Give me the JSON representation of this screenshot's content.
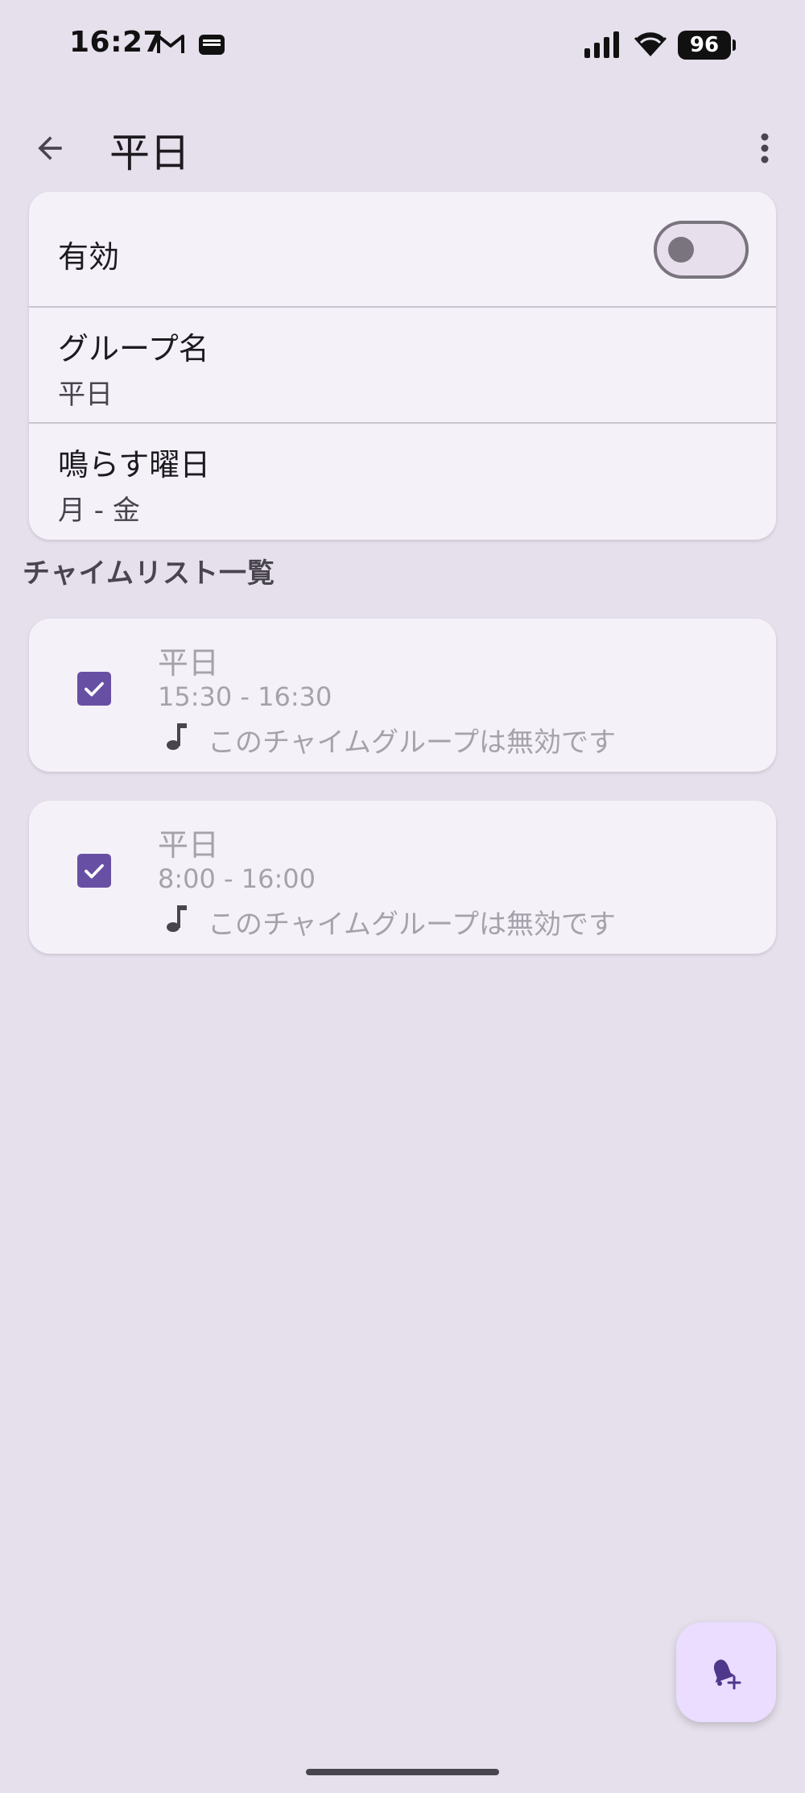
{
  "status_bar": {
    "time": "16:27",
    "battery": "96"
  },
  "app_bar": {
    "title": "平日"
  },
  "settings": {
    "enabled_label": "有効",
    "enabled": false,
    "group_name_label": "グループ名",
    "group_name_value": "平日",
    "days_label": "鳴らす曜日",
    "days_value": "月 - 金"
  },
  "section": {
    "title": "チャイムリスト一覧"
  },
  "chimes": [
    {
      "name": "平日",
      "time": "15:30 - 16:30",
      "status": "このチャイムグループは無効です",
      "checked": true
    },
    {
      "name": "平日",
      "time": "8:00 - 16:00",
      "status": "このチャイムグループは無効です",
      "checked": true
    }
  ],
  "colors": {
    "background": "#e6e0ec",
    "surface": "#f5f1f9",
    "primary": "#6750a4",
    "fab": "#eaddff"
  },
  "icons": {
    "back": "arrow-back-icon",
    "more": "more-vert-icon",
    "note": "music-note-icon",
    "fab": "add-alarm-bell-icon"
  }
}
